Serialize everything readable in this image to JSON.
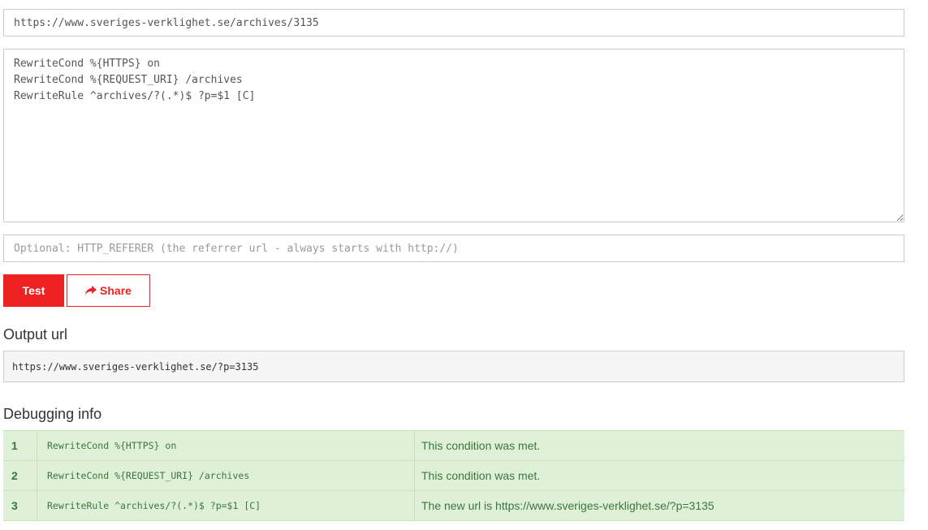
{
  "url_input": {
    "value": "https://www.sveriges-verklighet.se/archives/3135"
  },
  "rules_textarea": {
    "value": "RewriteCond %{HTTPS} on\nRewriteCond %{REQUEST_URI} /archives\nRewriteRule ^archives/?(.*)$ ?p=$1 [C]"
  },
  "referer_input": {
    "value": "",
    "placeholder": "Optional: HTTP_REFERER (the referrer url - always starts with http://)"
  },
  "buttons": {
    "test_label": "Test",
    "share_label": "Share",
    "share_icon": "share-arrow-icon"
  },
  "output": {
    "title": "Output url",
    "url": "https://www.sveriges-verklighet.se/?p=3135"
  },
  "debug": {
    "title": "Debugging info",
    "rows": [
      {
        "num": "1",
        "rule": "RewriteCond %{HTTPS} on",
        "message": "This condition was met."
      },
      {
        "num": "2",
        "rule": "RewriteCond %{REQUEST_URI} /archives",
        "message": "This condition was met."
      },
      {
        "num": "3",
        "rule": "RewriteRule ^archives/?(.*)$ ?p=$1 [C]",
        "message": "The new url is https://www.sveriges-verklighet.se/?p=3135"
      }
    ]
  },
  "colors": {
    "accent": "#ee2222",
    "success_bg": "#dff0d8",
    "success_text": "#3c763d",
    "output_bg": "#f5f5f5"
  }
}
